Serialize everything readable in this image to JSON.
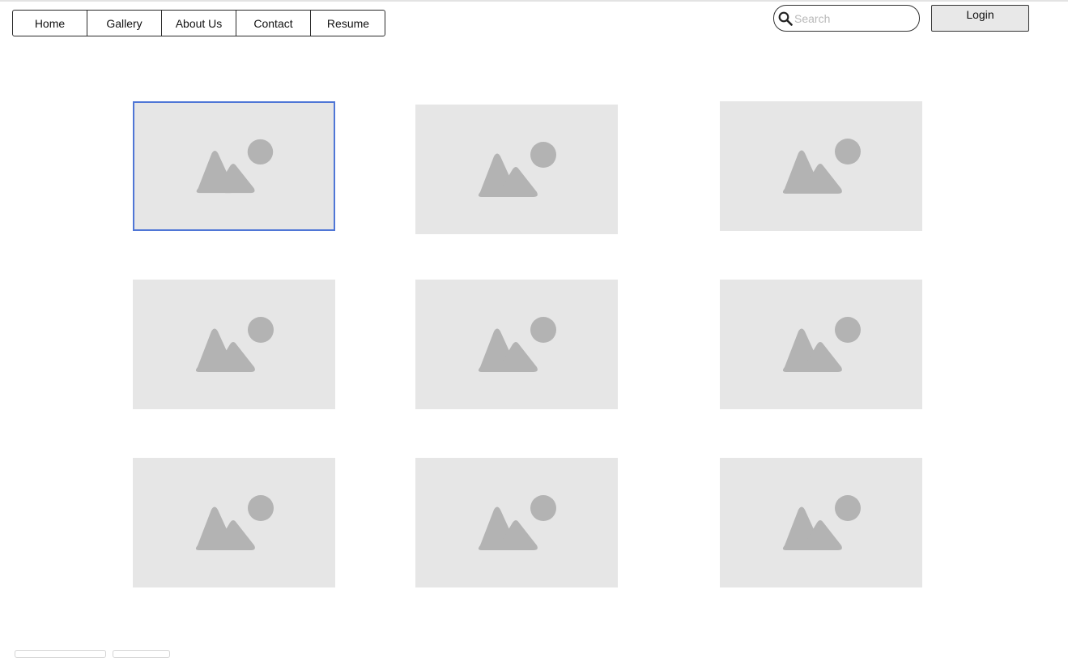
{
  "nav": {
    "items": [
      {
        "label": "Home"
      },
      {
        "label": "Gallery"
      },
      {
        "label": "About Us"
      },
      {
        "label": "Contact"
      },
      {
        "label": "Resume"
      }
    ]
  },
  "search": {
    "placeholder": "Search",
    "value": ""
  },
  "login": {
    "label": "Login"
  },
  "gallery": {
    "selected_index": 0,
    "image_count": 9
  },
  "colors": {
    "placeholder_bg": "#e6e6e6",
    "placeholder_icon": "#b3b3b3",
    "selection_border": "#4f76d6"
  }
}
